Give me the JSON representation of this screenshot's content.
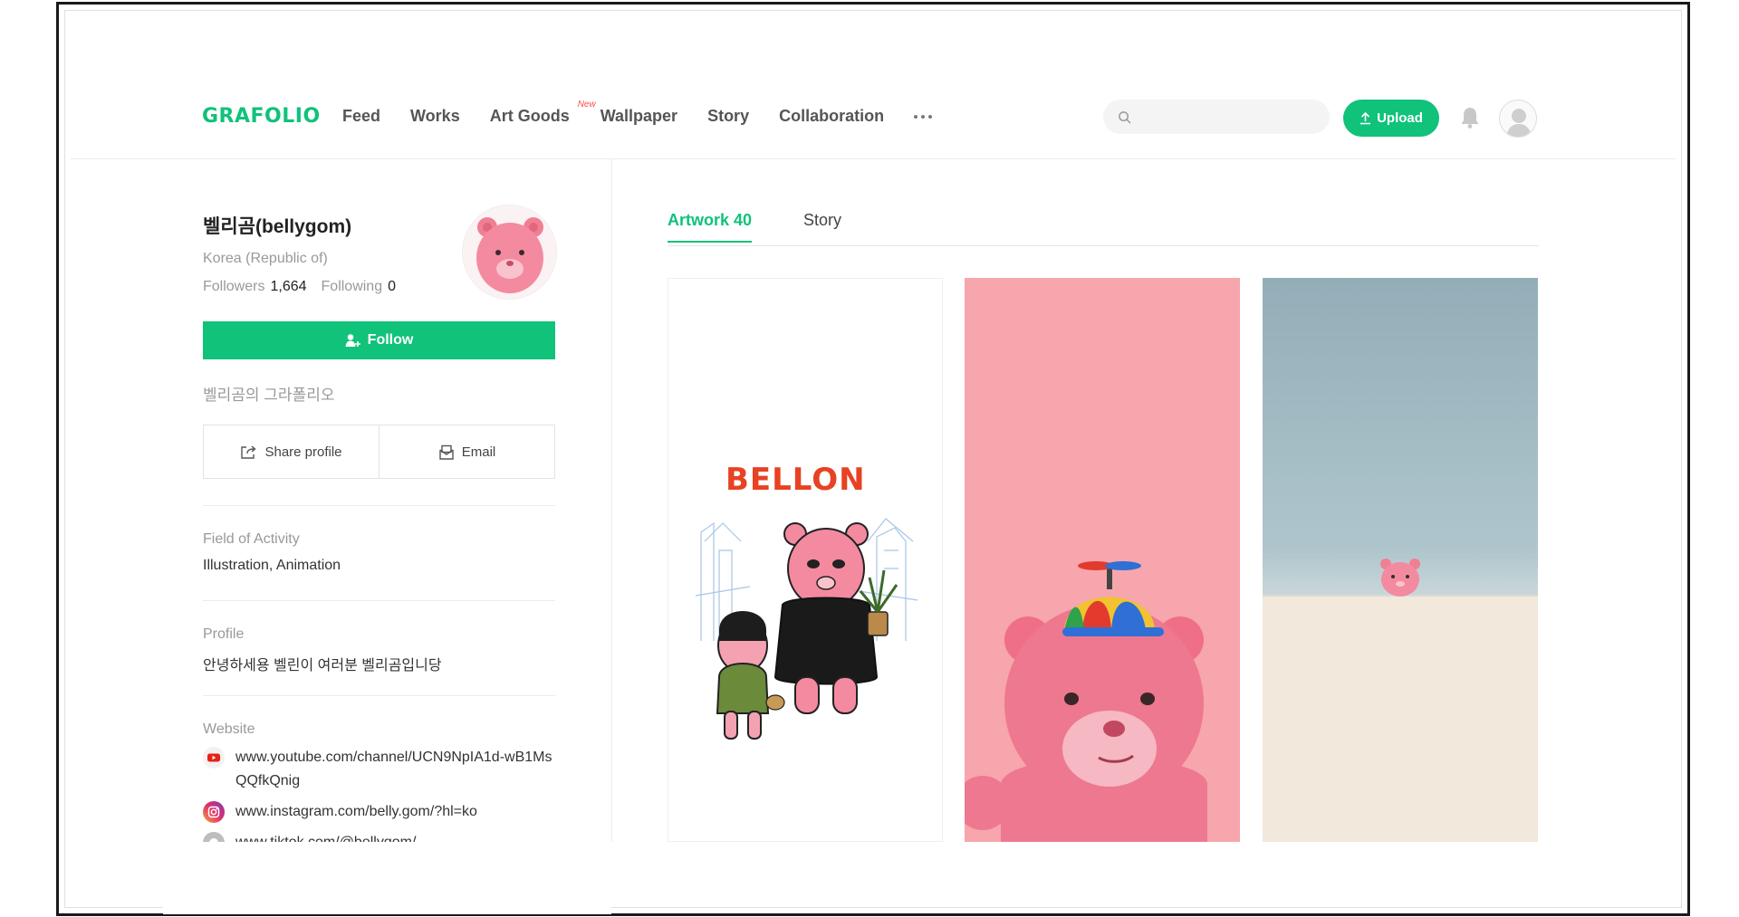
{
  "brand": {
    "logo": "GRAFOLIO",
    "accent": "#10c27a"
  },
  "nav": {
    "items": [
      "Feed",
      "Works",
      "Art Goods",
      "Wallpaper",
      "Story",
      "Collaboration"
    ],
    "new_badge": "New",
    "more_icon": "more-dots-icon"
  },
  "search": {
    "placeholder": ""
  },
  "upload_label": "Upload",
  "profile": {
    "name": "벨리곰(bellygom)",
    "country": "Korea (Republic of)",
    "followers_label": "Followers",
    "followers_count": "1,664",
    "following_label": "Following",
    "following_count": "0",
    "follow_label": "Follow",
    "description": "벨리곰의 그라폴리오",
    "share_label": "Share profile",
    "email_label": "Email",
    "field_label": "Field of Activity",
    "field_value": "Illustration, Animation",
    "profile_label": "Profile",
    "profile_value": "안녕하세용 벨린이 여러분 벨리곰입니당",
    "website_label": "Website",
    "websites": [
      {
        "icon": "youtube-icon",
        "url": "www.youtube.com/channel/UCN9NpIA1d-wB1MsQQfkQnig"
      },
      {
        "icon": "instagram-icon",
        "url": "www.instagram.com/belly.gom/?hl=ko"
      },
      {
        "icon": "tiktok-icon",
        "url": "www.tiktok.com/@bellygom/"
      }
    ]
  },
  "tabs": {
    "artwork": "Artwork 40",
    "story": "Story"
  },
  "artworks": [
    {
      "title_text": "BELLON"
    },
    {
      "title_text": ""
    },
    {
      "title_text": ""
    }
  ]
}
